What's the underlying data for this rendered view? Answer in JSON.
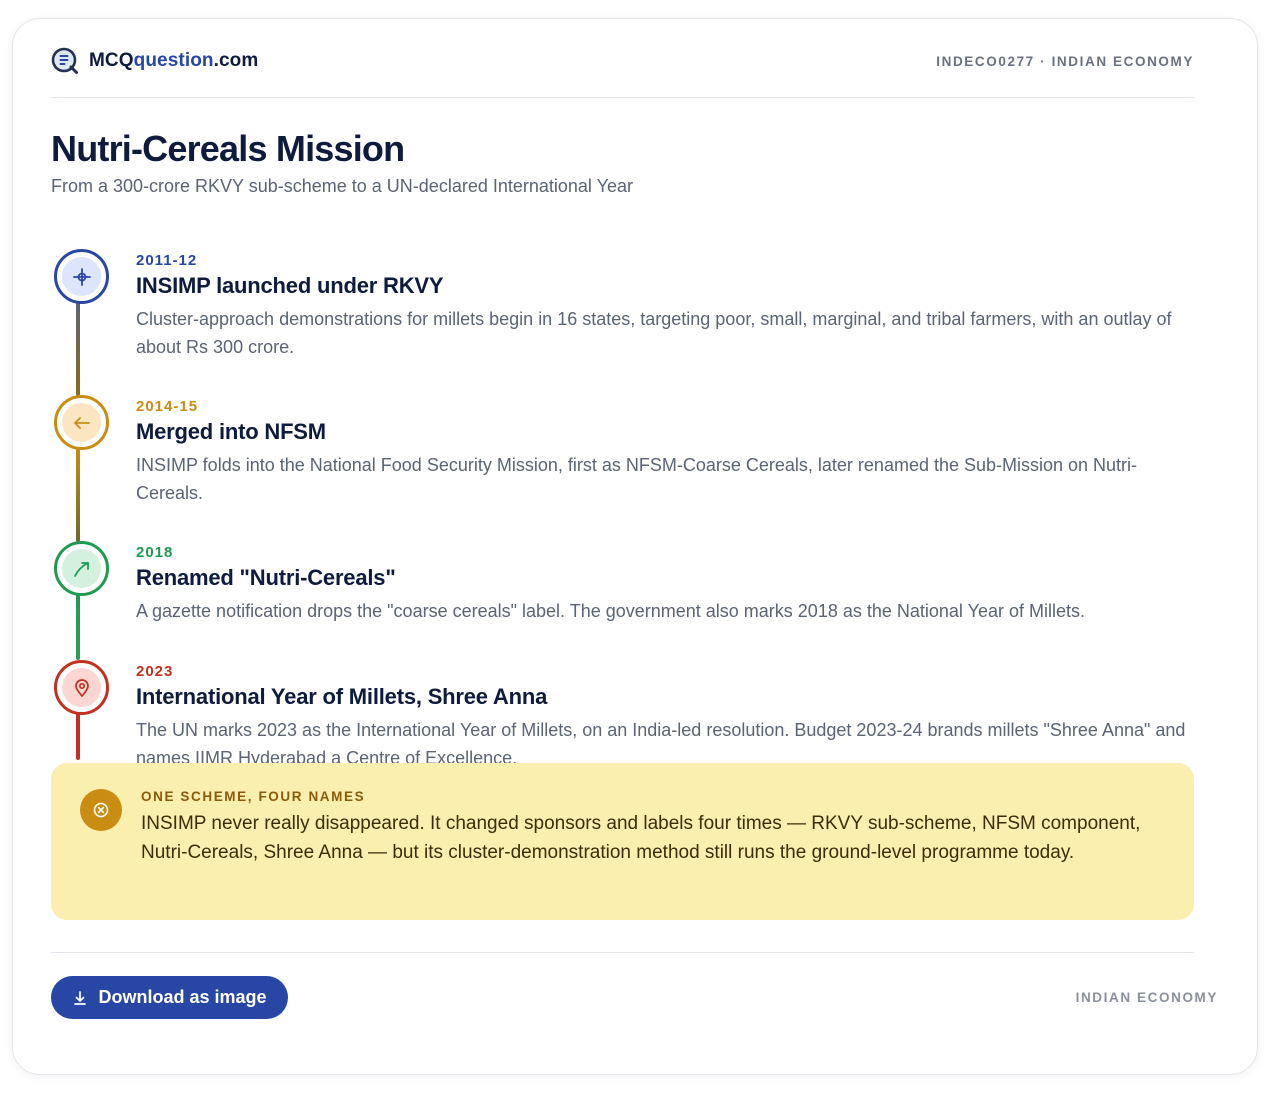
{
  "header": {
    "brand_prefix": "MCQ",
    "brand_accent": "question",
    "brand_suffix": ".com",
    "meta": "INDECO0277 · INDIAN ECONOMY"
  },
  "hero": {
    "title": "Nutri-Cereals Mission",
    "subtitle": "From a 300-crore RKVY sub-scheme to a UN-declared International Year"
  },
  "timeline": [
    {
      "date": "2011-12",
      "title": "INSIMP launched under RKVY",
      "description": "Cluster-approach demonstrations for millets begin in 16 states, targeting poor, small, marginal, and tribal farmers, with an outlay of about Rs 300 crore.",
      "icon": "crosshair-icon",
      "color": "#2847a4",
      "tint": "#dce5fb"
    },
    {
      "date": "2014-15",
      "title": "Merged into NFSM",
      "description": "INSIMP folds into the National Food Security Mission, first as NFSM-Coarse Cereals, later renamed the Sub-Mission on Nutri-Cereals.",
      "icon": "arrow-left-icon",
      "color": "#c98d13",
      "tint": "#fce6c2"
    },
    {
      "date": "2018",
      "title": "Renamed \"Nutri-Cereals\"",
      "description": "A gazette notification drops the \"coarse cereals\" label. The government also marks 2018 as the National Year of Millets.",
      "icon": "trending-arrow-icon",
      "color": "#1f9a52",
      "tint": "#d4f1df"
    },
    {
      "date": "2023",
      "title": "International Year of Millets, Shree Anna",
      "description": "The UN marks 2023 as the International Year of Millets, on an India-led resolution. Budget 2023-24 brands millets \"Shree Anna\" and names IIMR Hyderabad a Centre of Excellence.",
      "icon": "map-pin-icon",
      "color": "#c2311f",
      "tint": "#fbd6d2"
    }
  ],
  "note": {
    "label": "ONE SCHEME, FOUR NAMES",
    "text": "INSIMP never really disappeared. It changed sponsors and labels four times — RKVY sub-scheme, NFSM component, Nutri-Cereals, Shree Anna — but its cluster-demonstration method still runs the ground-level programme today.",
    "icon": "x-circle-icon",
    "color": "#c98d13",
    "background": "#fbefaf"
  },
  "footer": {
    "download_label": "Download as image",
    "tag": "INDIAN ECONOMY"
  },
  "colors": {
    "navy": "#0f1b3d",
    "accent": "#2847a4",
    "muted": "#5b6474"
  }
}
